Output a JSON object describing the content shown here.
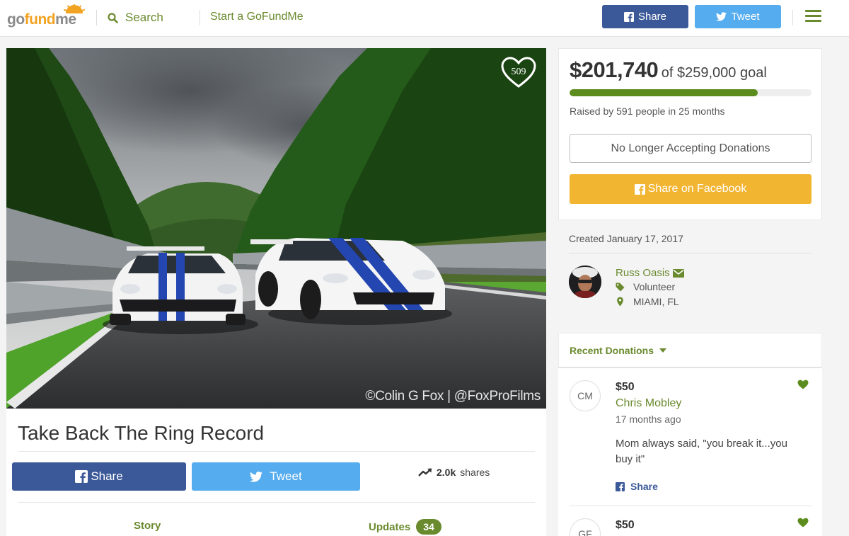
{
  "header": {
    "logo": "gofundme",
    "search_label": "Search",
    "start_label": "Start a GoFundMe",
    "share_label": "Share",
    "tweet_label": "Tweet"
  },
  "campaign": {
    "like_count": "509",
    "photo_credit": "©Colin G Fox | @FoxProFilms",
    "title": "Take Back The Ring Record",
    "share_label": "Share",
    "tweet_label": "Tweet",
    "shares_count": "2.0k",
    "shares_suffix": "shares",
    "tab_story": "Story",
    "tab_updates": "Updates",
    "updates_count": "34"
  },
  "donation": {
    "raised": "$201,740",
    "goal_text": "of $259,000 goal",
    "progress_fraction": 0.779,
    "raised_by": "Raised by 591 people in 25 months",
    "no_longer_label": "No Longer Accepting Donations",
    "share_fb_label": "Share on Facebook"
  },
  "organizer": {
    "created": "Created January 17, 2017",
    "name": "Russ Oasis",
    "role": "Volunteer",
    "location": "MIAMI, FL"
  },
  "recent": {
    "label": "Recent Donations",
    "items": [
      {
        "initials": "CM",
        "amount": "$50",
        "name": "Chris Mobley",
        "time": "17 months ago",
        "message": "Mom always said, \"you break it...you buy it\"",
        "share_label": "Share"
      },
      {
        "initials": "GF",
        "amount": "$50"
      }
    ]
  },
  "colors": {
    "brand_green": "#6a8a2e",
    "facebook": "#3b5998",
    "twitter": "#55acee",
    "accent_yellow": "#f2b531",
    "progress": "#5c8c1e"
  }
}
